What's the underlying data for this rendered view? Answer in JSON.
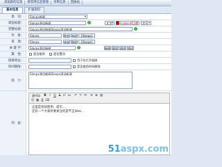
{
  "topnav": {
    "items": [
      "添加新的信息",
      "将常用信息管理",
      "待审信息",
      "回收站"
    ]
  },
  "tabs": [
    "基本信息",
    "扩展资料"
  ],
  "form": {
    "category": {
      "label": "类　别：",
      "value": "Slaspx新闻"
    },
    "title": {
      "label": "简短标题：",
      "value": "Slaspx测试新闻",
      "font_label": "文字",
      "color_value": "color:#C00",
      "size_label": "字号"
    },
    "full_title": {
      "label": "完整标题：",
      "value": "Slaspx测试新闻Slaspx测试新闻"
    },
    "author": {
      "label": "作　者：",
      "value": "Slaspx",
      "buttons": [
        "佚名",
        "本站",
        "[Slaspx]"
      ]
    },
    "source": {
      "label": "来　源：",
      "value": "Slaspx",
      "buttons": [
        "本站",
        "原创",
        "[Slaspx]"
      ]
    },
    "keywords": {
      "label": "关 键 字：",
      "value": "Slaspx测试新闻",
      "buttons": [
        "新闻",
        "测试",
        "测试",
        "测试"
      ]
    },
    "attributes": {
      "label": "属　性：",
      "options": [
        "是否推荐",
        "是否置顶"
      ]
    },
    "links": {
      "label": "链接地址：",
      "checkbox": "用于在打开链接"
    },
    "schedule": {
      "label": "时间期限：",
      "checkbox": "是否使用时间期限"
    },
    "summary": {
      "label": "简　介：",
      "value": "Slaspx测试新闻Slaspx测试新闻"
    },
    "content": {
      "label": "内　容：",
      "paragraphs": [
        "这里是测试使用，提示...",
        "还有一个大家所要关注的是不正Web..."
      ]
    }
  },
  "editor_buttons": [
    "源代码",
    "B",
    "I",
    "U",
    "S",
    "x²",
    "x₂",
    "↶",
    "↷",
    "⟲",
    "≡",
    "≣",
    "▤",
    "☺",
    "▦",
    "⎙",
    "⌫"
  ],
  "watermark": {
    "part1": "51",
    "part2": "aspx.com"
  }
}
